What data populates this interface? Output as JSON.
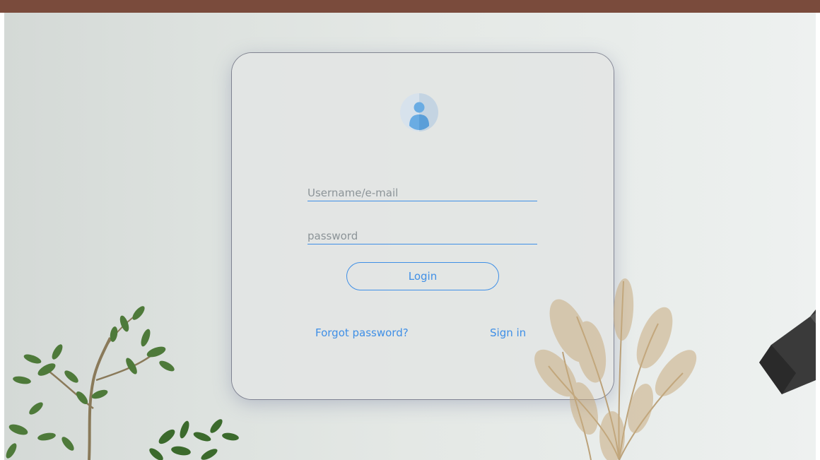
{
  "login": {
    "avatar": "user-avatar-icon",
    "username_placeholder": "Username/e-mail",
    "password_placeholder": "password",
    "login_label": "Login",
    "forgot_password_label": "Forgot password?",
    "sign_in_label": "Sign in"
  },
  "colors": {
    "accent": "#3f8fe6",
    "top_bar": "#7a4b3c",
    "card_background": "#e2e5e4"
  }
}
